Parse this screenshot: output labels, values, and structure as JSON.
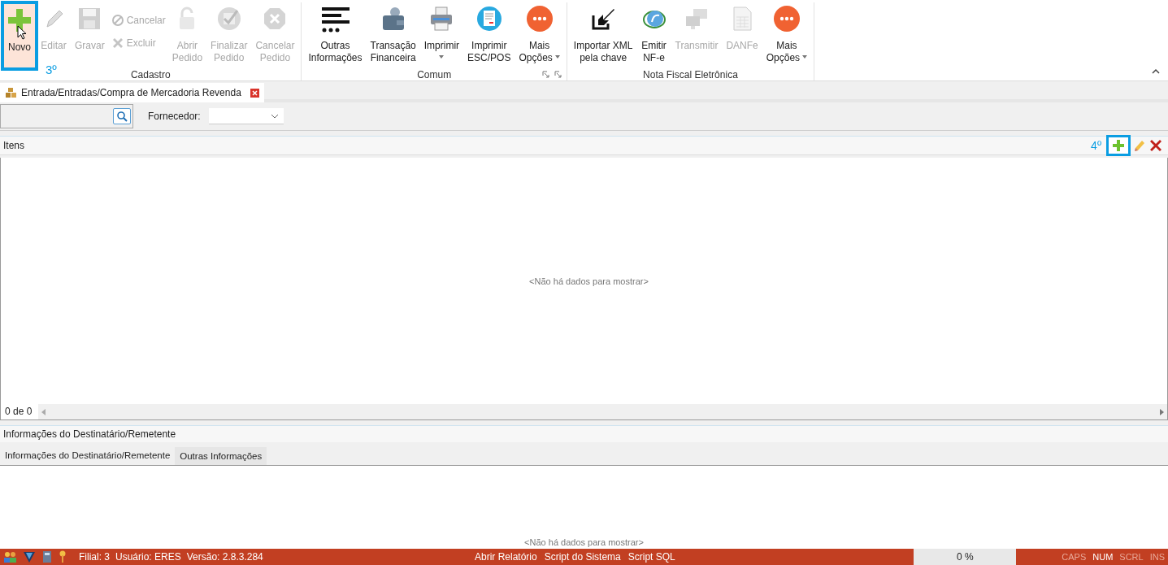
{
  "ribbon": {
    "groups": [
      {
        "label": "Cadastro",
        "launchers": false,
        "items": [
          {
            "kind": "large",
            "label": "Novo",
            "disabled": false,
            "highlighted": true,
            "annotation": "3º"
          },
          {
            "kind": "large",
            "label": "Editar",
            "disabled": true
          },
          {
            "kind": "large",
            "label": "Gravar",
            "disabled": true
          },
          {
            "kind": "small",
            "label": "Cancelar",
            "disabled": true
          },
          {
            "kind": "small",
            "label": "Excluir",
            "disabled": true
          },
          {
            "kind": "large",
            "label": "Abrir\nPedido",
            "disabled": true
          },
          {
            "kind": "large",
            "label": "Finalizar\nPedido",
            "disabled": true
          },
          {
            "kind": "large",
            "label": "Cancelar\nPedido",
            "disabled": true
          }
        ]
      },
      {
        "label": "Comum",
        "launchers": true,
        "items": [
          {
            "kind": "large",
            "label": "Outras\nInformações",
            "disabled": false
          },
          {
            "kind": "large",
            "label": "Transação\nFinanceira",
            "disabled": false
          },
          {
            "kind": "large",
            "label": "Imprimir",
            "disabled": false,
            "dropdown": true
          },
          {
            "kind": "large",
            "label": "Imprimir\nESC/POS",
            "disabled": false
          },
          {
            "kind": "large",
            "label": "Mais\nOpções",
            "disabled": false,
            "dropdown": true
          }
        ]
      },
      {
        "label": "Nota Fiscal Eletrônica",
        "launchers": false,
        "items": [
          {
            "kind": "large",
            "label": "Importar XML\npela chave",
            "disabled": false
          },
          {
            "kind": "large",
            "label": "Emitir\nNF-e",
            "disabled": false
          },
          {
            "kind": "large",
            "label": "Transmitir",
            "disabled": true
          },
          {
            "kind": "large",
            "label": "DANFe",
            "disabled": true
          },
          {
            "kind": "large",
            "label": "Mais\nOpções",
            "disabled": false,
            "dropdown": true
          }
        ]
      }
    ]
  },
  "document_tab": {
    "label": "Entrada/Entradas/Compra de Mercadoria Revenda"
  },
  "filter": {
    "fornecedor_label": "Fornecedor:"
  },
  "items_panel": {
    "title": "Itens",
    "annotation": "4º",
    "empty_text": "<Não há dados para mostrar>",
    "record_count": "0 de 0"
  },
  "recipient_panel": {
    "title": "Informações do Destinatário/Remetente",
    "tabs": [
      {
        "label": "Informações do Destinatário/Remetente",
        "selected": true
      },
      {
        "label": "Outras Informações",
        "selected": false
      }
    ],
    "empty_text": "<Não há dados para mostrar>"
  },
  "status_bar": {
    "left": [
      "Filial: 3",
      "Usuário: ERES",
      "Versão: 2.8.3.284"
    ],
    "links": [
      "Abrir Relatório",
      "Script do Sistema",
      "Script SQL"
    ],
    "progress": {
      "level": 0,
      "reading": "0 %"
    },
    "indicators": [
      {
        "label": "CAPS",
        "on": false
      },
      {
        "label": "NUM",
        "on": true
      },
      {
        "label": "SCRL",
        "on": false
      },
      {
        "label": "INS",
        "on": false
      }
    ]
  }
}
